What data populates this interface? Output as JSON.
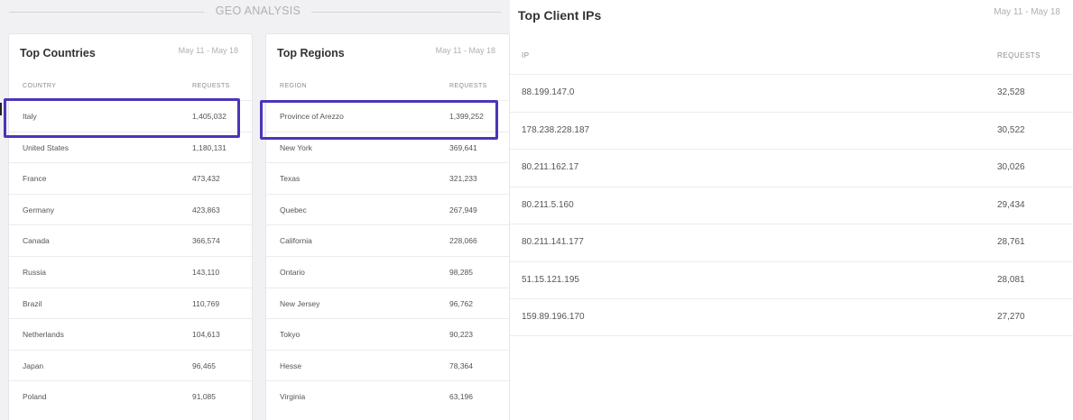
{
  "section": {
    "title": "GEO ANALYSIS"
  },
  "countries": {
    "title": "Top Countries",
    "date_range": "May 11 - May 18",
    "col_name": "COUNTRY",
    "col_value": "REQUESTS",
    "rows": [
      {
        "name": "Italy",
        "value": "1,405,032"
      },
      {
        "name": "United States",
        "value": "1,180,131"
      },
      {
        "name": "France",
        "value": "473,432"
      },
      {
        "name": "Germany",
        "value": "423,863"
      },
      {
        "name": "Canada",
        "value": "366,574"
      },
      {
        "name": "Russia",
        "value": "143,110"
      },
      {
        "name": "Brazil",
        "value": "110,769"
      },
      {
        "name": "Netherlands",
        "value": "104,613"
      },
      {
        "name": "Japan",
        "value": "96,465"
      },
      {
        "name": "Poland",
        "value": "91,085"
      }
    ]
  },
  "regions": {
    "title": "Top Regions",
    "date_range": "May 11 - May 18",
    "col_name": "REGION",
    "col_value": "REQUESTS",
    "rows": [
      {
        "name": "Province of Arezzo",
        "value": "1,399,252"
      },
      {
        "name": "New York",
        "value": "369,641"
      },
      {
        "name": "Texas",
        "value": "321,233"
      },
      {
        "name": "Quebec",
        "value": "267,949"
      },
      {
        "name": "California",
        "value": "228,066"
      },
      {
        "name": "Ontario",
        "value": "98,285"
      },
      {
        "name": "New Jersey",
        "value": "96,762"
      },
      {
        "name": "Tokyo",
        "value": "90,223"
      },
      {
        "name": "Hesse",
        "value": "78,364"
      },
      {
        "name": "Virginia",
        "value": "63,196"
      }
    ]
  },
  "client_ips": {
    "title": "Top Client IPs",
    "date_range": "May 11 - May 18",
    "col_name": "IP",
    "col_value": "REQUESTS",
    "rows": [
      {
        "name": "88.199.147.0",
        "value": "32,528"
      },
      {
        "name": "178.238.228.187",
        "value": "30,522"
      },
      {
        "name": "80.211.162.17",
        "value": "30,026"
      },
      {
        "name": "80.211.5.160",
        "value": "29,434"
      },
      {
        "name": "80.211.141.177",
        "value": "28,761"
      },
      {
        "name": "51.15.121.195",
        "value": "28,081"
      },
      {
        "name": "159.89.196.170",
        "value": "27,270"
      }
    ]
  },
  "colors": {
    "highlight": "#4b35b8",
    "background": "#f1f1f3",
    "card": "#ffffff"
  }
}
